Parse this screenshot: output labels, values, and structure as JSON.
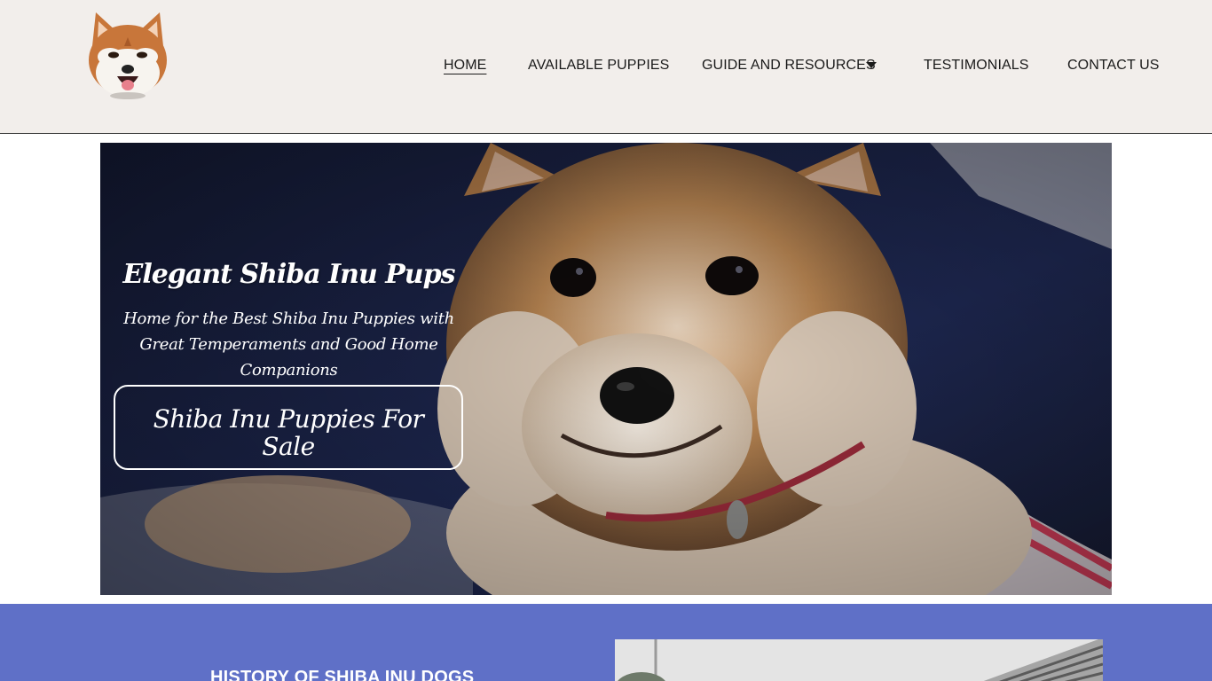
{
  "header": {
    "logo_icon": "shiba-inu-logo",
    "nav": [
      {
        "label": "HOME",
        "active": true
      },
      {
        "label": "AVAILABLE PUPPIES",
        "active": false
      },
      {
        "label": "GUIDE AND RESOURCES",
        "active": false,
        "dropdown_icon": "caret-down-icon"
      },
      {
        "label": "TESTIMONIALS",
        "active": false
      },
      {
        "label": "CONTACT US",
        "active": false
      }
    ]
  },
  "hero": {
    "title": "Elegant Shiba Inu Pups",
    "subtitle": "Home for the Best Shiba Inu Puppies with Great Temperaments and Good Home Companions",
    "cta_label": "Shiba Inu Puppies For Sale"
  },
  "section": {
    "title": "HISTORY OF SHIBA INU DOGS",
    "background": "#5f70c7"
  },
  "colors": {
    "header_bg": "#f2eeeb",
    "section_bg": "#5f70c7"
  }
}
